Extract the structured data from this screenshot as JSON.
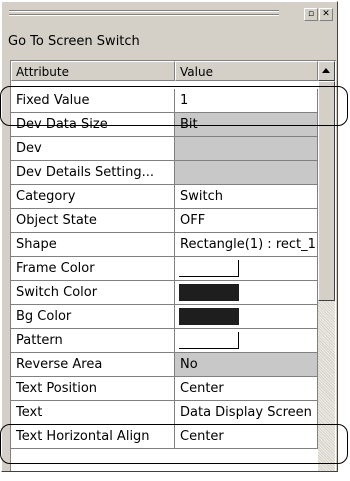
{
  "window": {
    "title": "Go To Screen Switch",
    "restore_glyph": "▫",
    "close_glyph": "✕"
  },
  "grid": {
    "columns": [
      "Attribute",
      "Value"
    ],
    "rows": [
      {
        "attr": "Fixed Value",
        "value": "1",
        "type": "text"
      },
      {
        "attr": "Dev Data Size",
        "value": "Bit",
        "type": "gray"
      },
      {
        "attr": "Dev",
        "value": "",
        "type": "gray"
      },
      {
        "attr": "Dev Details Setting...",
        "value": "",
        "type": "gray"
      },
      {
        "attr": "Category",
        "value": "Switch",
        "type": "text"
      },
      {
        "attr": "Object State",
        "value": "OFF",
        "type": "text"
      },
      {
        "attr": "Shape",
        "value": "Rectangle(1) : rect_1",
        "type": "text"
      },
      {
        "attr": "Frame Color",
        "value": "",
        "type": "swatch-white"
      },
      {
        "attr": "Switch Color",
        "value": "",
        "type": "swatch-dark"
      },
      {
        "attr": "Bg Color",
        "value": "",
        "type": "swatch-dark"
      },
      {
        "attr": "Pattern",
        "value": "",
        "type": "swatch-white"
      },
      {
        "attr": "Reverse Area",
        "value": "No",
        "type": "gray"
      },
      {
        "attr": "Text Position",
        "value": "Center",
        "type": "text"
      },
      {
        "attr": "Text",
        "value": "Data Display Screen",
        "type": "text"
      },
      {
        "attr": "Text Horizontal Align",
        "value": "Center",
        "type": "text"
      }
    ]
  },
  "colors": {
    "panel_bg": "#d4d0c8",
    "cell_gray": "#c8c8c8",
    "swatch_dark": "#1e1e1e"
  },
  "highlighted_rows": [
    "Fixed Value",
    "Text"
  ]
}
